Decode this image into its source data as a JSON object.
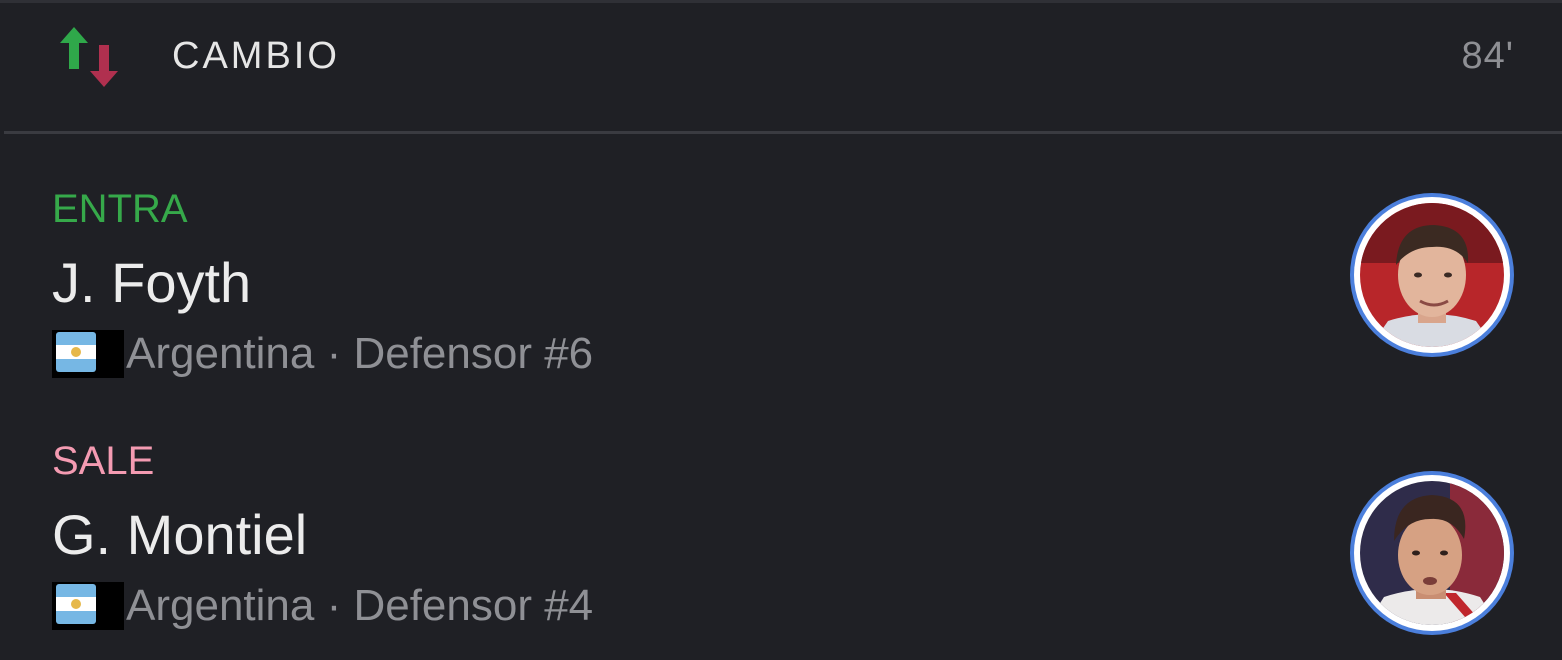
{
  "header": {
    "icon": "swap-arrows-icon",
    "title": "CAMBIO",
    "minute": "84'"
  },
  "colors": {
    "background": "#1f2025",
    "in": "#36a94a",
    "out": "#f49bb2",
    "avatar_ring": "#4b7fdc",
    "muted": "#8f9095"
  },
  "player_in": {
    "tag": "ENTRA",
    "name": "J. Foyth",
    "flag_icon": "argentina-flag-icon",
    "meta": "Argentina · Defensor #6"
  },
  "player_out": {
    "tag": "SALE",
    "name": "G. Montiel",
    "flag_icon": "argentina-flag-icon",
    "meta": "Argentina · Defensor #4"
  }
}
